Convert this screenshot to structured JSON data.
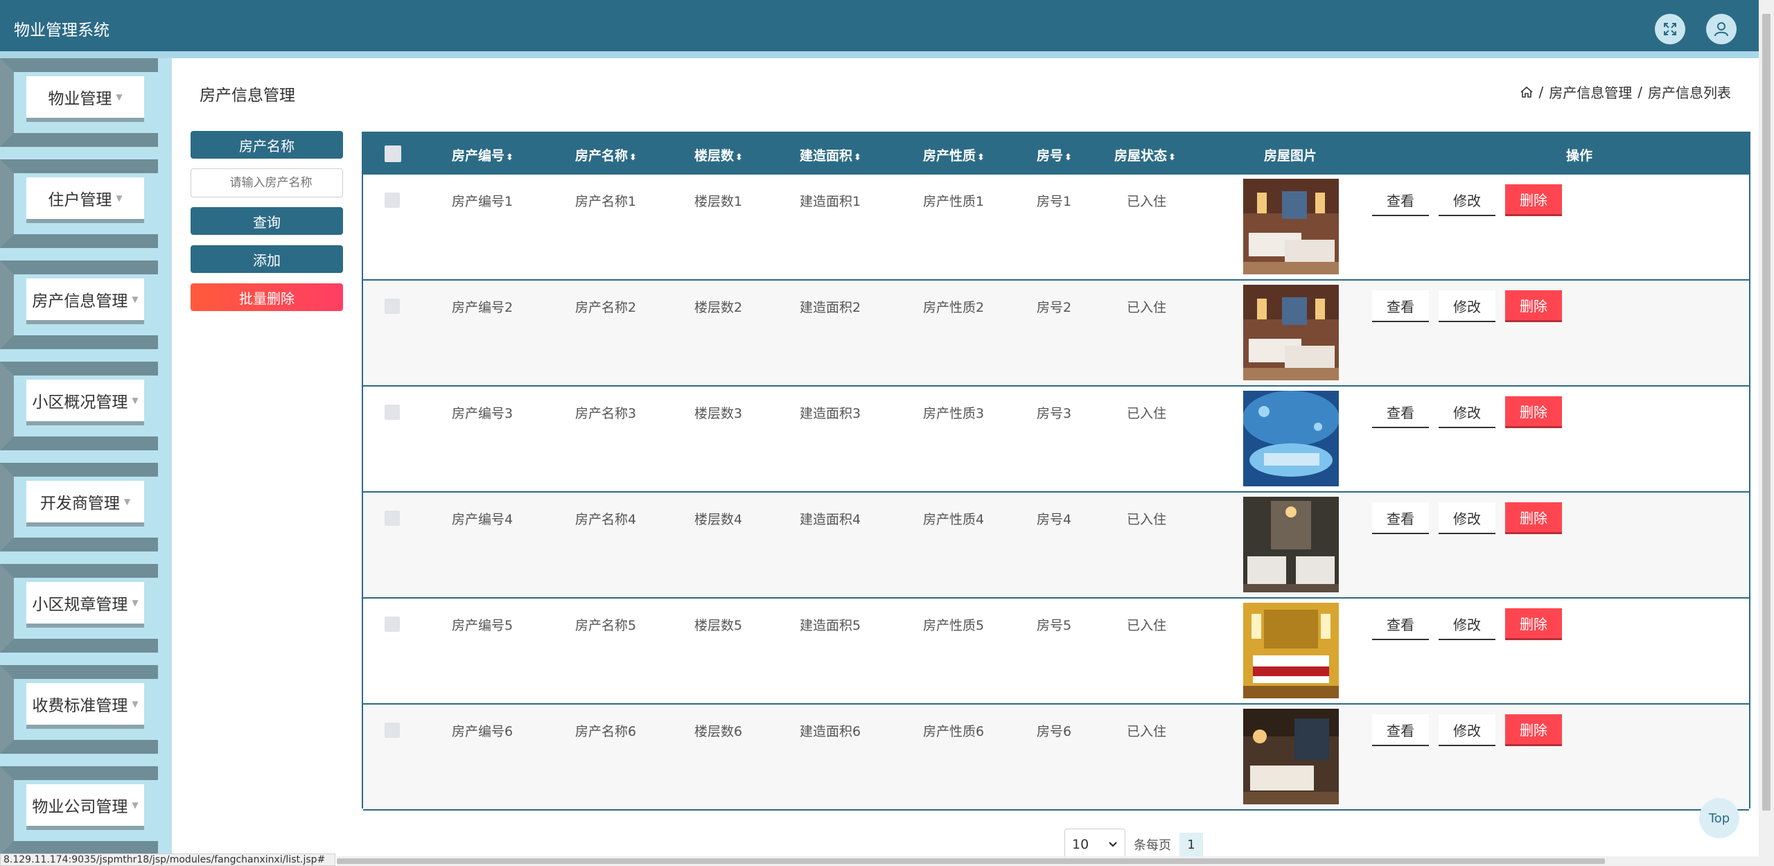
{
  "app": {
    "title": "物业管理系统"
  },
  "sidebar": {
    "items": [
      {
        "label": "物业管理"
      },
      {
        "label": "住户管理"
      },
      {
        "label": "房产信息管理"
      },
      {
        "label": "小区概况管理"
      },
      {
        "label": "开发商管理"
      },
      {
        "label": "小区规章管理"
      },
      {
        "label": "收费标准管理"
      },
      {
        "label": "物业公司管理"
      }
    ]
  },
  "page": {
    "title": "房产信息管理",
    "breadcrumb": [
      "房产信息管理",
      "房产信息列表"
    ],
    "separator": "/"
  },
  "filter": {
    "field_label": "房产名称",
    "placeholder": "请输入房产名称",
    "query_label": "查询",
    "add_label": "添加",
    "batch_delete_label": "批量删除"
  },
  "table": {
    "headers": [
      "房产编号",
      "房产名称",
      "楼层数",
      "建造面积",
      "房产性质",
      "房号",
      "房屋状态",
      "房屋图片",
      "操作"
    ],
    "rows": [
      {
        "code": "房产编号1",
        "name": "房产名称1",
        "floors": "楼层数1",
        "area": "建造面积1",
        "nature": "房产性质1",
        "room": "房号1",
        "status": "已入住"
      },
      {
        "code": "房产编号2",
        "name": "房产名称2",
        "floors": "楼层数2",
        "area": "建造面积2",
        "nature": "房产性质2",
        "room": "房号2",
        "status": "已入住"
      },
      {
        "code": "房产编号3",
        "name": "房产名称3",
        "floors": "楼层数3",
        "area": "建造面积3",
        "nature": "房产性质3",
        "room": "房号3",
        "status": "已入住"
      },
      {
        "code": "房产编号4",
        "name": "房产名称4",
        "floors": "楼层数4",
        "area": "建造面积4",
        "nature": "房产性质4",
        "room": "房号4",
        "status": "已入住"
      },
      {
        "code": "房产编号5",
        "name": "房产名称5",
        "floors": "楼层数5",
        "area": "建造面积5",
        "nature": "房产性质5",
        "room": "房号5",
        "status": "已入住"
      },
      {
        "code": "房产编号6",
        "name": "房产名称6",
        "floors": "楼层数6",
        "area": "建造面积6",
        "nature": "房产性质6",
        "room": "房号6",
        "status": "已入住"
      }
    ],
    "actions": {
      "view": "查看",
      "edit": "修改",
      "delete": "删除"
    }
  },
  "pagination": {
    "page_size": "10",
    "per_page_label": "条每页",
    "current_page": "1"
  },
  "top_button": "Top",
  "status_url": "8.129.11.174:9035/jspmthr18/jsp/modules/fangchanxinxi/list.jsp#",
  "colors": {
    "primary": "#2c6b86",
    "sidebar_bg": "#b9e2ef",
    "danger": "#ff4650"
  }
}
